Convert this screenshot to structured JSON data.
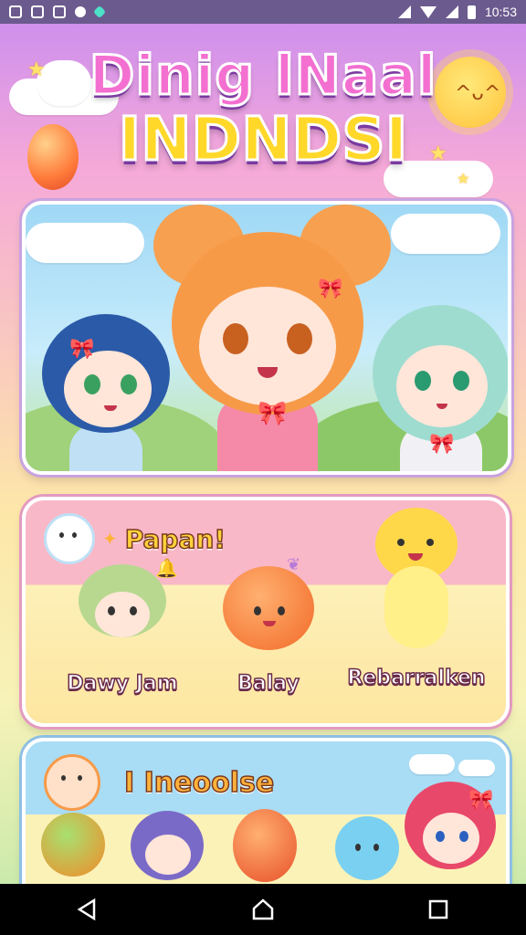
{
  "status_bar": {
    "time": "10:53",
    "left_icons": [
      "notification-icon",
      "notification-icon",
      "notification-icon",
      "notification-icon",
      "app-icon"
    ],
    "right_icons": [
      "signal-icon",
      "wifi-icon",
      "signal-icon",
      "battery-icon"
    ]
  },
  "title": {
    "line1": "Dinig lNaal",
    "line2": "INDNDSI"
  },
  "panel_favorites": {
    "title": "Papan!",
    "items": [
      {
        "label": "Dawy Jam"
      },
      {
        "label": "Balay"
      },
      {
        "label": "Rebarralken"
      }
    ]
  },
  "panel_second": {
    "title": "I Ineoolse",
    "items_labels": [
      "",
      "",
      "",
      "",
      ""
    ]
  },
  "nav": {
    "back": "back-icon",
    "home": "home-icon",
    "recents": "recents-icon"
  },
  "colors": {
    "title_pink": "#f36fd0",
    "title_yellow": "#ffd82a",
    "status_bar": "#6b5a8e",
    "nav_bar": "#000000"
  }
}
